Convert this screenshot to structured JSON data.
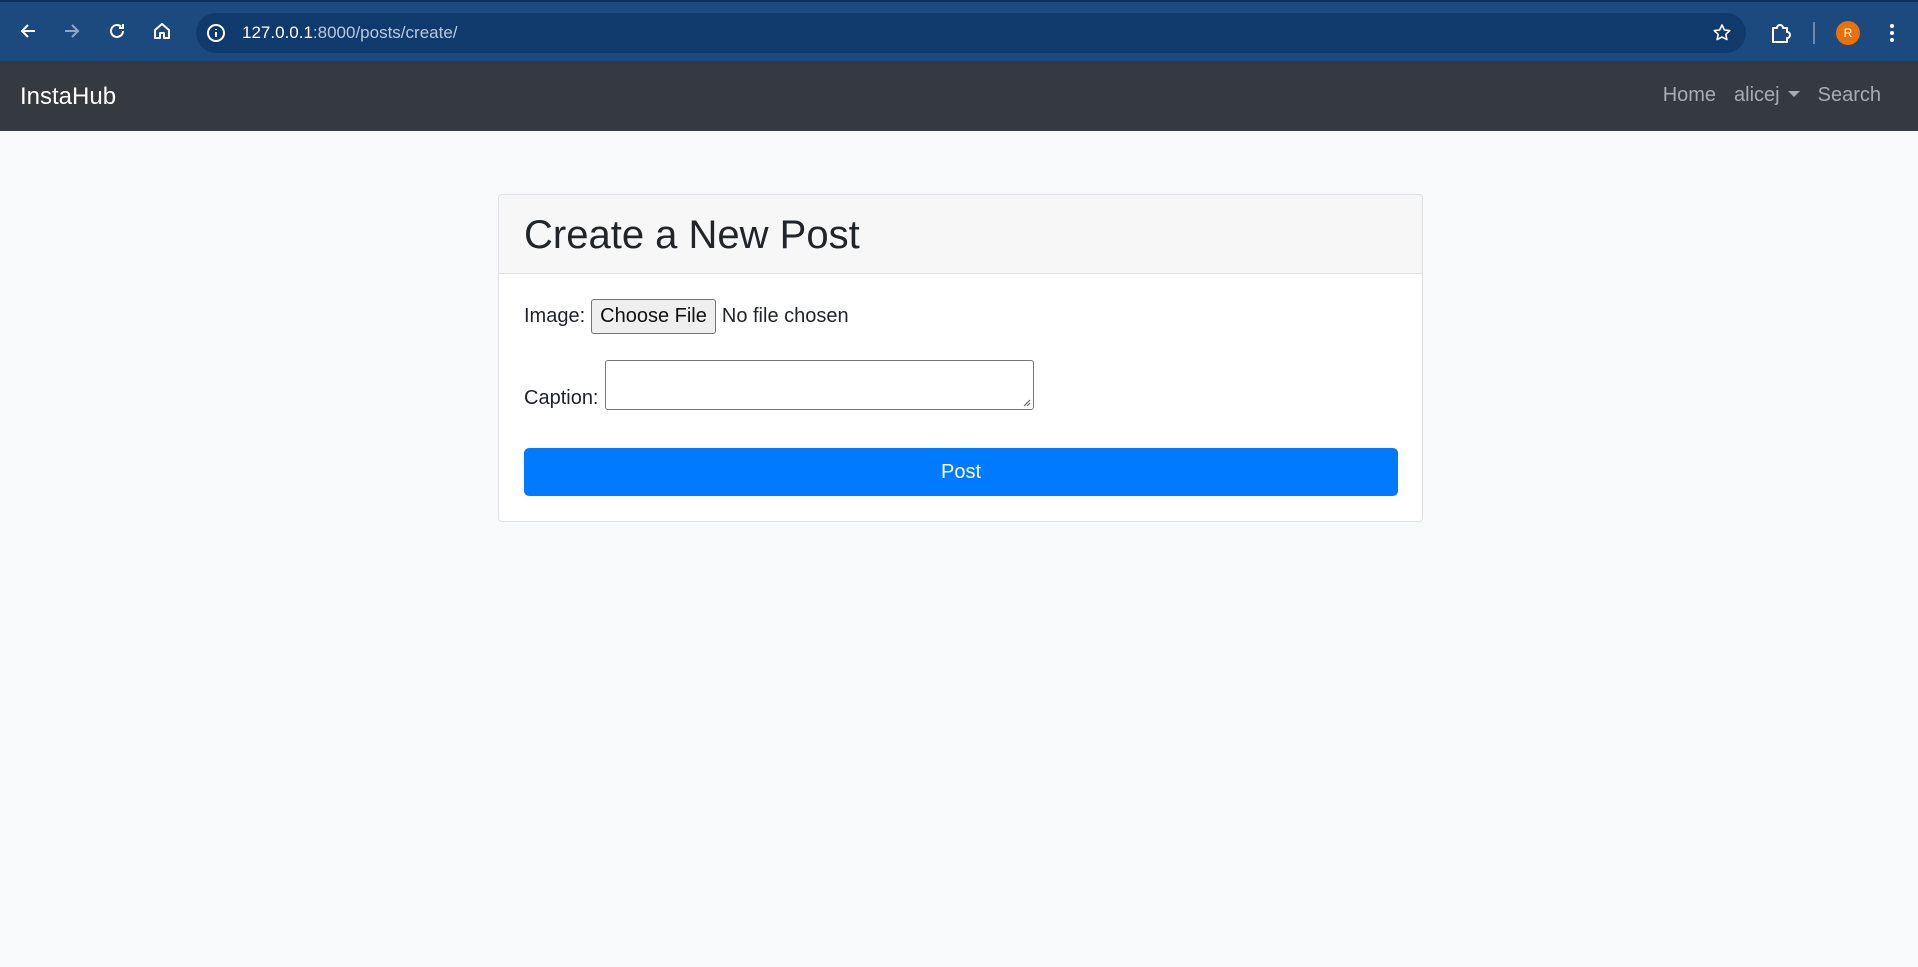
{
  "browser": {
    "url_host": "127.0.0.1",
    "url_path": ":8000/posts/create/",
    "profile_initial": "R"
  },
  "navbar": {
    "brand": "InstaHub",
    "links": {
      "home": "Home",
      "user": "alicej",
      "search": "Search"
    }
  },
  "form": {
    "title": "Create a New Post",
    "image_label": "Image:",
    "file_button": "Choose File",
    "file_status": "No file chosen",
    "caption_label": "Caption:",
    "caption_value": "",
    "submit_label": "Post"
  },
  "colors": {
    "navbar_bg": "#343a40",
    "primary": "#007bff",
    "browser_bar": "#1d4a7e"
  }
}
